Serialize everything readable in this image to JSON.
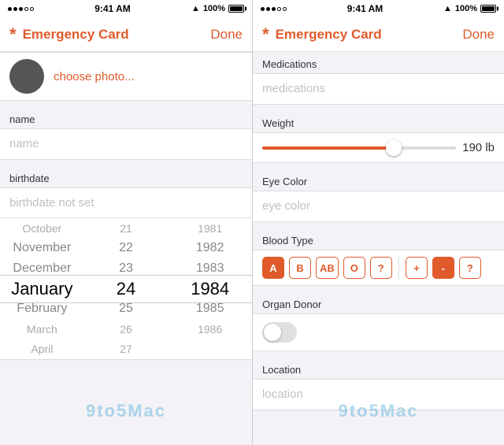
{
  "left_panel": {
    "status": {
      "time": "9:41 AM",
      "battery": "100%"
    },
    "header": {
      "asterisk": "*",
      "title": "Emergency Card",
      "done": "Done"
    },
    "photo": {
      "label": "choose photo..."
    },
    "name_section": {
      "label": "name",
      "placeholder": "name"
    },
    "birthdate_section": {
      "label": "birthdate",
      "placeholder": "birthdate not set"
    },
    "picker": {
      "months": [
        "October",
        "November",
        "December",
        "January",
        "February",
        "March",
        "April"
      ],
      "days": [
        "21",
        "22",
        "23",
        "24",
        "25",
        "26",
        "27"
      ],
      "years": [
        "1981",
        "1982",
        "1983",
        "1984",
        "1985",
        "1986",
        ""
      ]
    },
    "watermark": "9to5Mac"
  },
  "right_panel": {
    "status": {
      "time": "9:41 AM",
      "battery": "100%"
    },
    "header": {
      "asterisk": "*",
      "title": "Emergency Card",
      "done": "Done"
    },
    "medications": {
      "label": "Medications",
      "placeholder": "medications"
    },
    "weight": {
      "label": "Weight",
      "value": "190",
      "unit": "lb"
    },
    "eye_color": {
      "label": "Eye Color",
      "placeholder": "eye color"
    },
    "blood_type": {
      "label": "Blood Type",
      "buttons": [
        "A",
        "B",
        "AB",
        "O",
        "?",
        "+",
        "-",
        "?"
      ],
      "selected": "A",
      "selected2": "-"
    },
    "organ_donor": {
      "label": "Organ Donor"
    },
    "location": {
      "label": "Location",
      "placeholder": "location"
    },
    "watermark": "9to5Mac"
  }
}
